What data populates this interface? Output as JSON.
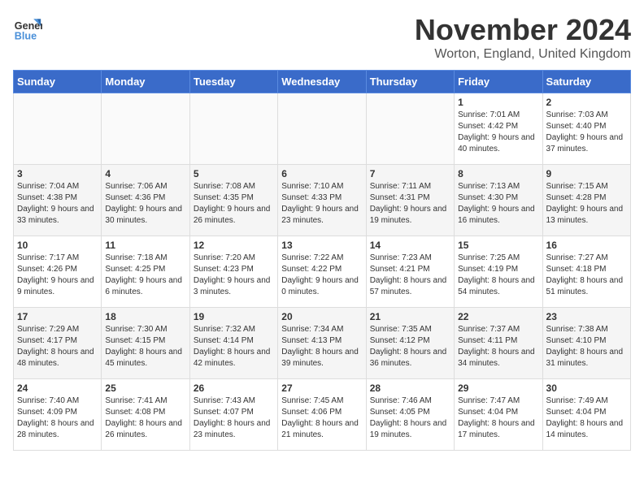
{
  "logo": {
    "line1": "General",
    "line2": "Blue"
  },
  "title": "November 2024",
  "location": "Worton, England, United Kingdom",
  "days_of_week": [
    "Sunday",
    "Monday",
    "Tuesday",
    "Wednesday",
    "Thursday",
    "Friday",
    "Saturday"
  ],
  "weeks": [
    [
      {
        "day": "",
        "info": ""
      },
      {
        "day": "",
        "info": ""
      },
      {
        "day": "",
        "info": ""
      },
      {
        "day": "",
        "info": ""
      },
      {
        "day": "",
        "info": ""
      },
      {
        "day": "1",
        "info": "Sunrise: 7:01 AM\nSunset: 4:42 PM\nDaylight: 9 hours and 40 minutes."
      },
      {
        "day": "2",
        "info": "Sunrise: 7:03 AM\nSunset: 4:40 PM\nDaylight: 9 hours and 37 minutes."
      }
    ],
    [
      {
        "day": "3",
        "info": "Sunrise: 7:04 AM\nSunset: 4:38 PM\nDaylight: 9 hours and 33 minutes."
      },
      {
        "day": "4",
        "info": "Sunrise: 7:06 AM\nSunset: 4:36 PM\nDaylight: 9 hours and 30 minutes."
      },
      {
        "day": "5",
        "info": "Sunrise: 7:08 AM\nSunset: 4:35 PM\nDaylight: 9 hours and 26 minutes."
      },
      {
        "day": "6",
        "info": "Sunrise: 7:10 AM\nSunset: 4:33 PM\nDaylight: 9 hours and 23 minutes."
      },
      {
        "day": "7",
        "info": "Sunrise: 7:11 AM\nSunset: 4:31 PM\nDaylight: 9 hours and 19 minutes."
      },
      {
        "day": "8",
        "info": "Sunrise: 7:13 AM\nSunset: 4:30 PM\nDaylight: 9 hours and 16 minutes."
      },
      {
        "day": "9",
        "info": "Sunrise: 7:15 AM\nSunset: 4:28 PM\nDaylight: 9 hours and 13 minutes."
      }
    ],
    [
      {
        "day": "10",
        "info": "Sunrise: 7:17 AM\nSunset: 4:26 PM\nDaylight: 9 hours and 9 minutes."
      },
      {
        "day": "11",
        "info": "Sunrise: 7:18 AM\nSunset: 4:25 PM\nDaylight: 9 hours and 6 minutes."
      },
      {
        "day": "12",
        "info": "Sunrise: 7:20 AM\nSunset: 4:23 PM\nDaylight: 9 hours and 3 minutes."
      },
      {
        "day": "13",
        "info": "Sunrise: 7:22 AM\nSunset: 4:22 PM\nDaylight: 9 hours and 0 minutes."
      },
      {
        "day": "14",
        "info": "Sunrise: 7:23 AM\nSunset: 4:21 PM\nDaylight: 8 hours and 57 minutes."
      },
      {
        "day": "15",
        "info": "Sunrise: 7:25 AM\nSunset: 4:19 PM\nDaylight: 8 hours and 54 minutes."
      },
      {
        "day": "16",
        "info": "Sunrise: 7:27 AM\nSunset: 4:18 PM\nDaylight: 8 hours and 51 minutes."
      }
    ],
    [
      {
        "day": "17",
        "info": "Sunrise: 7:29 AM\nSunset: 4:17 PM\nDaylight: 8 hours and 48 minutes."
      },
      {
        "day": "18",
        "info": "Sunrise: 7:30 AM\nSunset: 4:15 PM\nDaylight: 8 hours and 45 minutes."
      },
      {
        "day": "19",
        "info": "Sunrise: 7:32 AM\nSunset: 4:14 PM\nDaylight: 8 hours and 42 minutes."
      },
      {
        "day": "20",
        "info": "Sunrise: 7:34 AM\nSunset: 4:13 PM\nDaylight: 8 hours and 39 minutes."
      },
      {
        "day": "21",
        "info": "Sunrise: 7:35 AM\nSunset: 4:12 PM\nDaylight: 8 hours and 36 minutes."
      },
      {
        "day": "22",
        "info": "Sunrise: 7:37 AM\nSunset: 4:11 PM\nDaylight: 8 hours and 34 minutes."
      },
      {
        "day": "23",
        "info": "Sunrise: 7:38 AM\nSunset: 4:10 PM\nDaylight: 8 hours and 31 minutes."
      }
    ],
    [
      {
        "day": "24",
        "info": "Sunrise: 7:40 AM\nSunset: 4:09 PM\nDaylight: 8 hours and 28 minutes."
      },
      {
        "day": "25",
        "info": "Sunrise: 7:41 AM\nSunset: 4:08 PM\nDaylight: 8 hours and 26 minutes."
      },
      {
        "day": "26",
        "info": "Sunrise: 7:43 AM\nSunset: 4:07 PM\nDaylight: 8 hours and 23 minutes."
      },
      {
        "day": "27",
        "info": "Sunrise: 7:45 AM\nSunset: 4:06 PM\nDaylight: 8 hours and 21 minutes."
      },
      {
        "day": "28",
        "info": "Sunrise: 7:46 AM\nSunset: 4:05 PM\nDaylight: 8 hours and 19 minutes."
      },
      {
        "day": "29",
        "info": "Sunrise: 7:47 AM\nSunset: 4:04 PM\nDaylight: 8 hours and 17 minutes."
      },
      {
        "day": "30",
        "info": "Sunrise: 7:49 AM\nSunset: 4:04 PM\nDaylight: 8 hours and 14 minutes."
      }
    ]
  ]
}
